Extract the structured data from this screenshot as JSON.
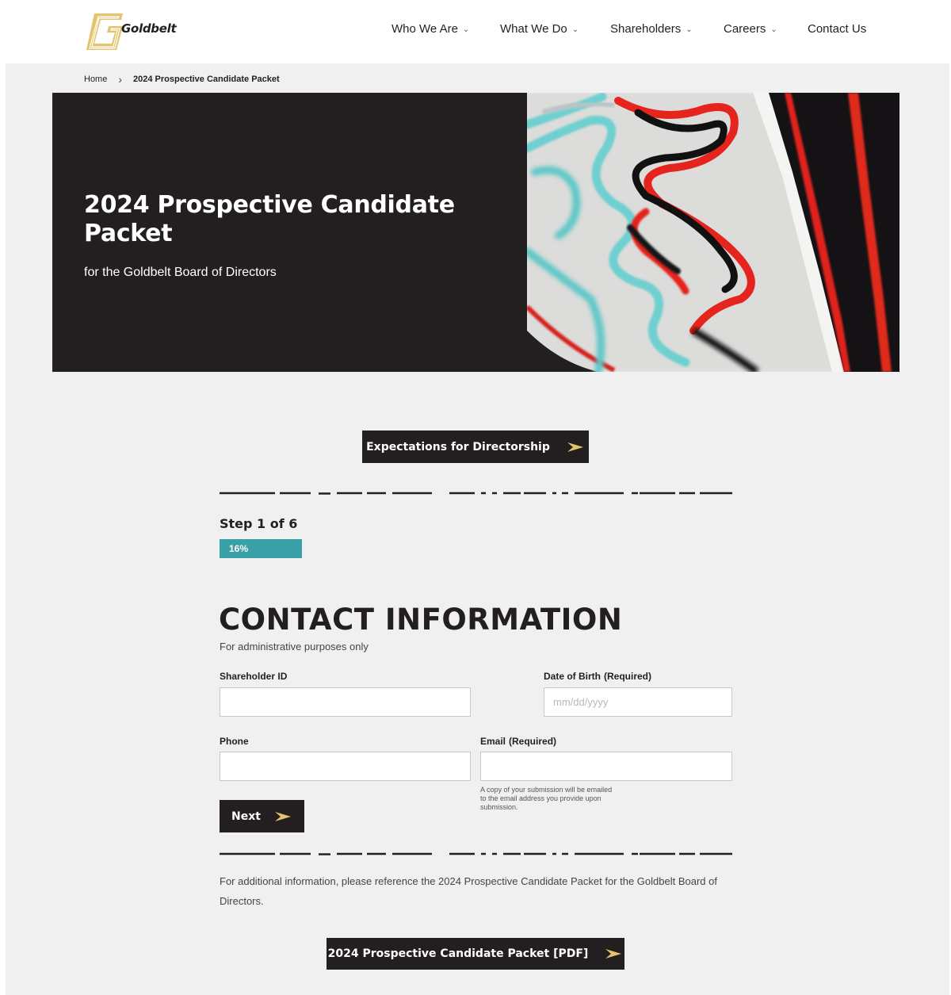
{
  "header": {
    "logo_text": "Goldbelt",
    "nav": [
      {
        "label": "Who We Are",
        "has_menu": true
      },
      {
        "label": "What We Do",
        "has_menu": true
      },
      {
        "label": "Shareholders",
        "has_menu": true
      },
      {
        "label": "Careers",
        "has_menu": true
      },
      {
        "label": "Contact Us",
        "has_menu": false
      }
    ]
  },
  "breadcrumb": {
    "home": "Home",
    "current": "2024 Prospective Candidate Packet"
  },
  "hero": {
    "title": "2024 Prospective Candidate Packet",
    "subtitle": "for the Goldbelt Board of Directors"
  },
  "expectations_button": "Expectations for Directorship",
  "form": {
    "step_label": "Step 1 of 6",
    "progress_percent": 16,
    "progress_text": "16%",
    "section_title": "CONTACT INFORMATION",
    "section_subtitle": "For administrative purposes only",
    "fields": {
      "shareholder_id": {
        "label": "Shareholder ID",
        "value": "",
        "placeholder": ""
      },
      "dob": {
        "label": "Date of Birth",
        "required_text": "(Required)",
        "value": "",
        "placeholder": "mm/dd/yyyy"
      },
      "phone": {
        "label": "Phone",
        "value": "",
        "placeholder": ""
      },
      "email": {
        "label": "Email",
        "required_text": "(Required)",
        "value": "",
        "placeholder": "",
        "helper": "A copy of your submission will be emailed to the email address you provide upon submission."
      }
    },
    "next_button": "Next"
  },
  "footer_info": "For additional information, please reference the 2024 Prospective Candidate Packet for the Goldbelt Board of Directors.",
  "pdf_button": "2024 Prospective Candidate Packet [PDF]",
  "colors": {
    "dark": "#231f20",
    "gold": "#e3c36b",
    "teal": "#3aa0a8",
    "page_bg": "#f0f0f0"
  }
}
